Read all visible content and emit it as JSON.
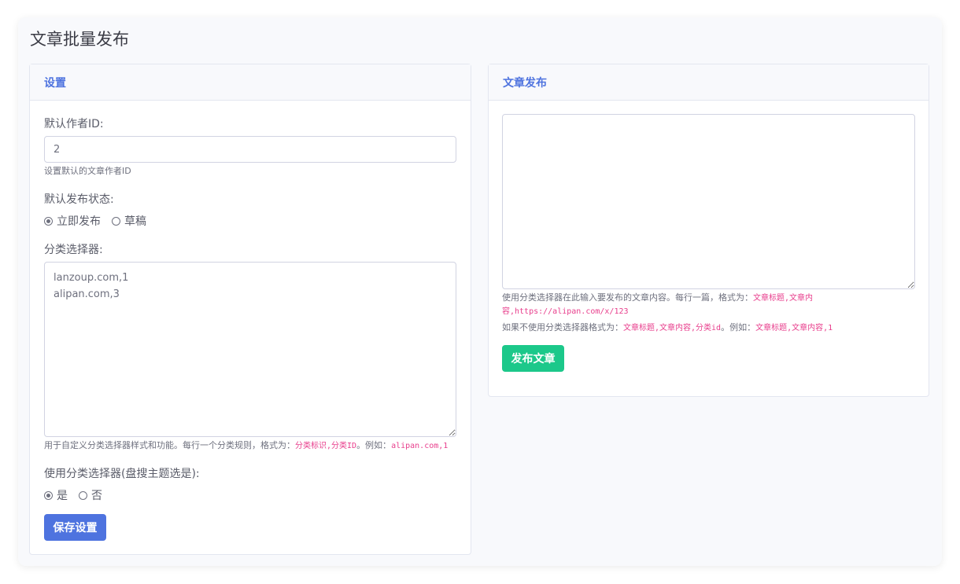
{
  "page": {
    "title": "文章批量发布"
  },
  "settings": {
    "header": "设置",
    "author_id_label": "默认作者ID:",
    "author_id_value": "2",
    "author_id_help": "设置默认的文章作者ID",
    "status_label": "默认发布状态:",
    "status_options": [
      "立即发布",
      "草稿"
    ],
    "status_selected": "立即发布",
    "selector_label": "分类选择器:",
    "selector_value": "lanzoup.com,1\nalipan.com,3",
    "selector_help_prefix": "用于自定义分类选择器样式和功能。每行一个分类规则，格式为：",
    "selector_help_code1": "分类标识,分类ID",
    "selector_help_mid": "。例如：",
    "selector_help_code2": "alipan.com,1",
    "use_selector_label": "使用分类选择器(盘搜主题选是):",
    "use_selector_options": [
      "是",
      "否"
    ],
    "use_selector_selected": "是",
    "save_label": "保存设置"
  },
  "publish": {
    "header": "文章发布",
    "content_value": "",
    "help1_prefix": "使用分类选择器在此输入要发布的文章内容。每行一篇，格式为：",
    "help1_code": "文章标题,文章内容,https://alipan.com/x/123",
    "help2_prefix": "如果不使用分类选择器格式为：",
    "help2_code1": "文章标题,文章内容,分类id",
    "help2_mid": "。例如：",
    "help2_code2": "文章标题,文章内容,1",
    "publish_label": "发布文章"
  },
  "colors": {
    "primary": "#4e73df",
    "success": "#1cc88a",
    "code": "#e83e8c"
  }
}
